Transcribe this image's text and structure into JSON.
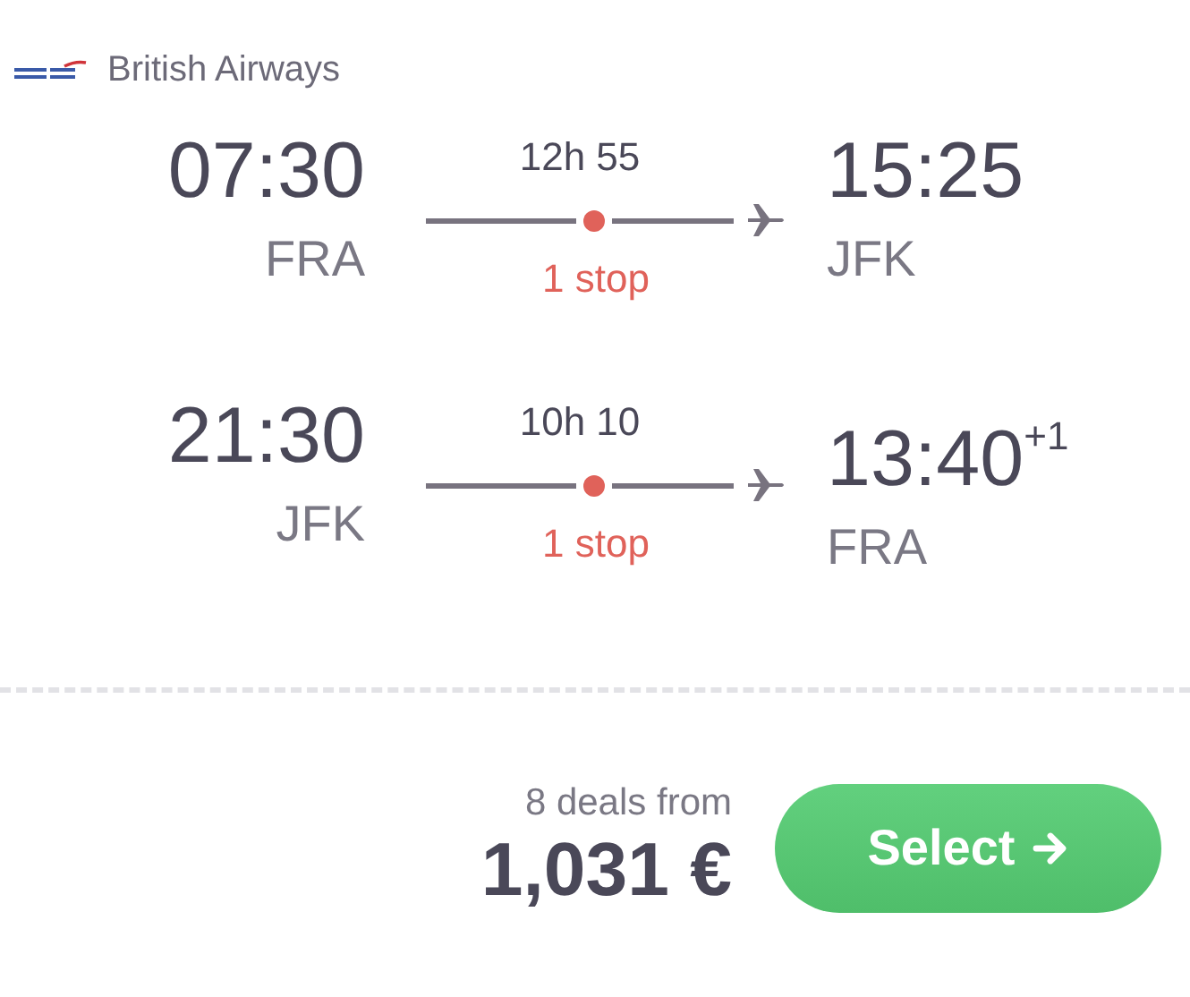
{
  "airline": {
    "name": "British Airways"
  },
  "legs": [
    {
      "departure_time": "07:30",
      "departure_airport": "FRA",
      "duration": "12h 55",
      "stops": "1 stop",
      "arrival_time": "15:25",
      "arrival_airport": "JFK"
    },
    {
      "departure_time": "21:30",
      "departure_airport": "JFK",
      "duration": "10h 10",
      "stops": "1 stop",
      "arrival_time": "13:40$^{+1}$",
      "arrival_airport": "FRA"
    }
  ],
  "footer": {
    "deals": "8 deals from",
    "price": "1,031 €",
    "button": "Select"
  }
}
